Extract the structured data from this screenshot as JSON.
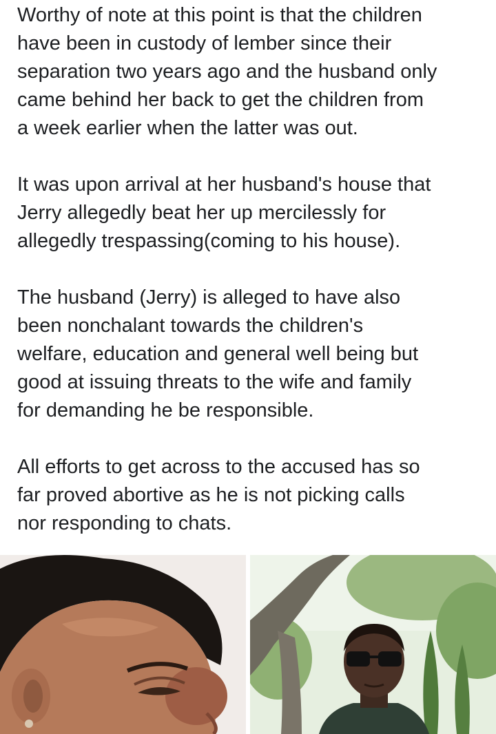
{
  "post": {
    "paragraphs": [
      {
        "lines": [
          "Worthy of note at this point is that the children",
          "have been in custody of lember since their",
          "separation two years ago and the husband only",
          "came behind her back to get the children from",
          "a week earlier when the latter was out."
        ]
      },
      {
        "lines": [
          "It was upon arrival at her husband's house that",
          "Jerry allegedly beat her up mercilessly for",
          "allegedly trespassing(coming to his house)."
        ]
      },
      {
        "lines": [
          "The husband (Jerry) is alleged to have also",
          "been nonchalant towards the children's",
          "welfare, education and general well being but",
          "good at issuing threats to the wife and family",
          "for demanding he be responsible."
        ]
      },
      {
        "lines": [
          "All efforts to get across to the accused has so",
          "far proved abortive as he is not picking calls",
          "nor responding to chats."
        ]
      }
    ]
  },
  "photos": {
    "left": {
      "subject": "woman-with-facial-swelling"
    },
    "right": {
      "subject": "man-in-sunglasses-outdoors"
    }
  },
  "colors": {
    "text": "#1c1e21",
    "background": "#ffffff"
  }
}
